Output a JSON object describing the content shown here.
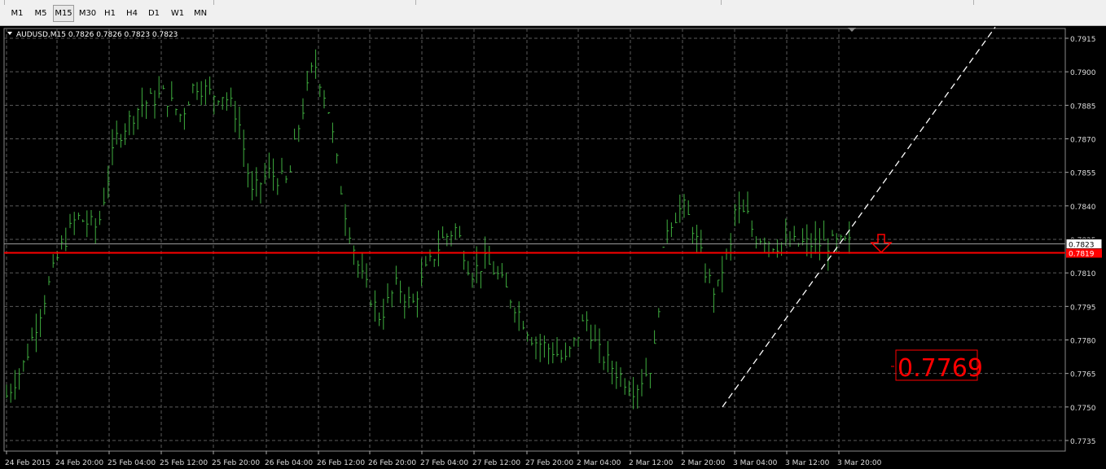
{
  "toolbar": {
    "timeframes": [
      {
        "label": "M1",
        "active": false
      },
      {
        "label": "M5",
        "active": false
      },
      {
        "label": "M15",
        "active": true
      },
      {
        "label": "M30",
        "active": false
      },
      {
        "label": "H1",
        "active": false
      },
      {
        "label": "H4",
        "active": false
      },
      {
        "label": "D1",
        "active": false
      },
      {
        "label": "W1",
        "active": false
      },
      {
        "label": "MN",
        "active": false
      }
    ]
  },
  "chart_header": {
    "symbol_line": "AUDUSD,M15  0.7826 0.7826 0.7823 0.7823"
  },
  "colors": {
    "background": "#000000",
    "grid": "#5a5a5a",
    "candles": "#3fae3f",
    "horizontal_line": "#ff0000",
    "trendline": "#ffffff",
    "price_marker_current": "#ffffff",
    "price_marker_level": "#ff0000"
  },
  "annotation": {
    "price_text": "0.7769",
    "arrow_icon": "down-arrow-icon"
  },
  "chart_data": {
    "type": "line",
    "symbol": "AUDUSD",
    "timeframe": "M15",
    "ylim": [
      0.7735,
      0.792
    ],
    "y_ticks": [
      "0.7915",
      "0.7900",
      "0.7885",
      "0.7870",
      "0.7855",
      "0.7840",
      "0.7825",
      "0.7810",
      "0.7795",
      "0.7780",
      "0.7765",
      "0.7750",
      "0.7735"
    ],
    "x_ticks": [
      "24 Feb 2015",
      "24 Feb 20:00",
      "25 Feb 04:00",
      "25 Feb 12:00",
      "25 Feb 20:00",
      "26 Feb 04:00",
      "26 Feb 12:00",
      "26 Feb 20:00",
      "27 Feb 04:00",
      "27 Feb 12:00",
      "27 Feb 20:00",
      "2 Mar 04:00",
      "2 Mar 12:00",
      "2 Mar 20:00",
      "3 Mar 04:00",
      "3 Mar 12:00",
      "3 Mar 20:00"
    ],
    "current_price": "0.7823",
    "horizontal_level": "0.7819",
    "grid": true,
    "series": [
      {
        "x_time_ticks": [
          0,
          3.6,
          6.3,
          10.6,
          13.9,
          18.1,
          21.7,
          26.5,
          31.2,
          34.7,
          37.3,
          40.6,
          43.1,
          45.9,
          48.7,
          51.9,
          55.9,
          57.4,
          61.0,
          63.7,
          66.9,
          70.1,
          74.1,
          77.5,
          80.4,
          83.0,
          86.5,
          89.2,
          92.1,
          95.1,
          97.1,
          101.0,
          104.5,
          108.7,
          110.8,
          114.9,
          117.3,
          119.3,
          121.3,
          124.6,
          128.3,
          130.7,
          134.2,
          136.2,
          138.7,
          140.8,
          142.3,
          143.6,
          144.2,
          147.2,
          148.3,
          150.7,
          151.7,
          153.1,
          155.4,
          157.4,
          159.5,
          161.3,
          163.5,
          165.9,
          167.8
        ],
        "values": [
          0.7755,
          0.777,
          0.779,
          0.782,
          0.7835,
          0.783,
          0.787,
          0.7885,
          0.789,
          0.788,
          0.7895,
          0.789,
          0.789,
          0.788,
          0.7845,
          0.7855,
          0.785,
          0.787,
          0.7905,
          0.7885,
          0.784,
          0.781,
          0.779,
          0.7805,
          0.7795,
          0.781,
          0.7825,
          0.783,
          0.781,
          0.7815,
          0.781,
          0.7795,
          0.778,
          0.7775,
          0.777,
          0.779,
          0.7775,
          0.777,
          0.7765,
          0.7758,
          0.777,
          0.783,
          0.784,
          0.783,
          0.781,
          0.78,
          0.7815,
          0.782,
          0.7838,
          0.7835,
          0.7826,
          0.7826,
          0.7823,
          0.7823,
          0.7823,
          0.7823,
          0.7823,
          0.7823,
          0.7823,
          0.7823,
          0.7823
        ]
      }
    ],
    "trendline": {
      "from": {
        "x_index": 152.0,
        "value": 0.775
      },
      "to": {
        "x_index": 213.0,
        "value": 0.792
      }
    }
  }
}
